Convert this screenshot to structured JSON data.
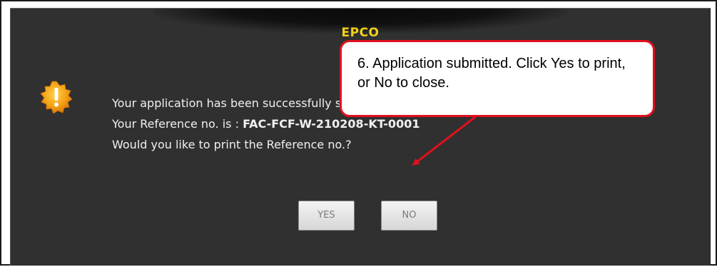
{
  "dialog": {
    "title": "EPCO",
    "icon": "warning-icon",
    "message_line1": "Your application has been successfully submitted.",
    "message_line2_label": "Your Reference no. is : ",
    "reference_no": "FAC-FCF-W-210208-KT-0001",
    "message_line3": "Would you like to print the Reference no.?",
    "yes_label": "YES",
    "no_label": "NO"
  },
  "callout": {
    "text": "6. Application submitted. Click Yes to print, or No to close.",
    "border_color": "#e0101e"
  },
  "colors": {
    "dialog_bg": "#303030",
    "title": "#f2d21a",
    "text": "#f0f0f0",
    "arrow": "#e0101e"
  }
}
